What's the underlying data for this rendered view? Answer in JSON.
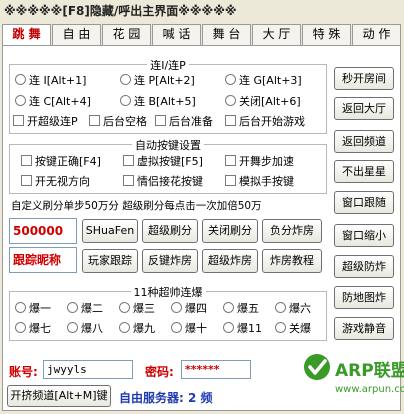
{
  "window": {
    "title": "※※※※※[F8]隐藏/呼出主界面※※※※※"
  },
  "tabs": [
    "跳 舞",
    "自 由",
    "花 园",
    "喊 话",
    "舞 台",
    "大 厅",
    "特 殊",
    "动 作"
  ],
  "connect": {
    "title": "连I/连P",
    "options": [
      "连 I[Alt+1]",
      "连 P[Alt+2]",
      "连 G[Alt+3]",
      "连 C[Alt+4]",
      "连 B[Alt+5]",
      "关闭[Alt+6]"
    ],
    "checks": [
      "开超级连P",
      "后台空格",
      "后台准备",
      "后台开始游戏"
    ]
  },
  "auto": {
    "title": "自动按键设置",
    "checks": [
      "按键正确[F4]",
      "虚拟按键[F5]",
      "开舞步加速",
      "开无视方向",
      "情侣接花按键",
      "模拟手按键"
    ]
  },
  "refresh": {
    "info": "自定义刷分单步50万分  超级刷分每点击一次加倍50万",
    "value": "500000",
    "nick": "跟踪昵称",
    "buttons": [
      "SHuaFen",
      "超级刷分",
      "关闭刷分",
      "负分炸房",
      "玩家跟踪",
      "反键炸房",
      "超级炸房",
      "炸房教程"
    ]
  },
  "burst": {
    "title": "11种超帅连爆",
    "options": [
      "爆一",
      "爆二",
      "爆三",
      "爆四",
      "爆五",
      "爆六",
      "爆七",
      "爆八",
      "爆九",
      "爆十",
      "爆11",
      "关爆"
    ]
  },
  "side_buttons": [
    "秒开房间",
    "返回大厅",
    "返回频道",
    "不出星星",
    "窗口跟随",
    "窗口缩小",
    "超级防炸",
    "防地图炸",
    "游戏静音"
  ],
  "account": {
    "label": "账号:",
    "value": "jwyyls",
    "pwd_label": "密码:",
    "pwd_value": "******"
  },
  "bottom": {
    "open_channel": "开挤频道[Alt+M]键",
    "server": "自由服务器: 2 频"
  },
  "watermark": {
    "brand": "ARP联盟",
    "url": "www.arpun.com",
    "logo_color": "#3a9a28"
  }
}
